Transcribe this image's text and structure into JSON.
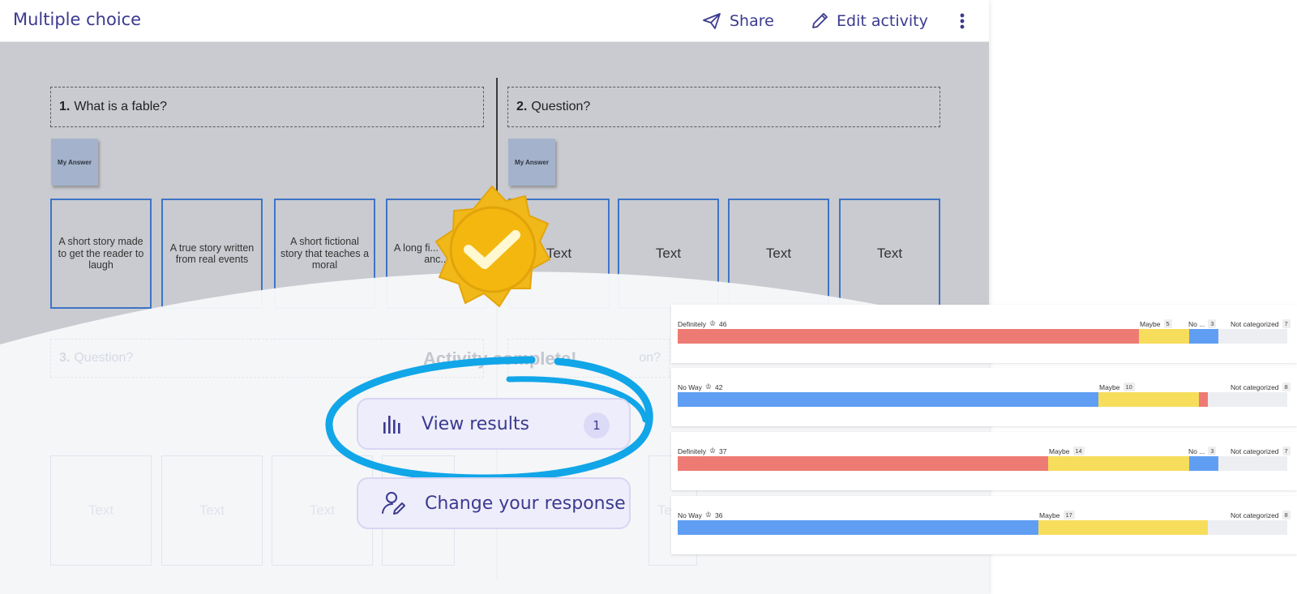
{
  "header": {
    "title": "Multiple choice",
    "share_label": "Share",
    "edit_label": "Edit activity"
  },
  "board": {
    "q1": {
      "num": "1.",
      "text": "What is a fable?"
    },
    "q2": {
      "num": "2.",
      "text": "Question?"
    },
    "q3": {
      "num": "3.",
      "text": "Question?"
    },
    "q4_partial": "on?",
    "sticky_label": "My Answer",
    "q1_options": [
      "A short story made to get the reader to laugh",
      "A true story written from real events",
      "A short fictional story that teaches a moral",
      "A long fi... with m... anc..."
    ],
    "q2_options": [
      "Text",
      "Text",
      "Text",
      "Text"
    ],
    "q3_options": [
      "Text",
      "Text",
      "Text",
      "Text"
    ],
    "q4_options": [
      "Text"
    ],
    "activity_complete": "Activity complete!"
  },
  "actions": {
    "view_results_label": "View results",
    "view_results_count": "1",
    "change_response_label": "Change your response"
  },
  "results": [
    {
      "left_label": "Definitely",
      "left_count": "46",
      "mid_label": "Maybe",
      "mid_count": "5",
      "third_label": "No ...",
      "third_count": "3",
      "nc_label": "Not categorized",
      "nc_count": "7",
      "segments": [
        {
          "color": "#ee7b73",
          "from": 0,
          "to": 0.757
        },
        {
          "color": "#f7dd5c",
          "from": 0.757,
          "to": 0.839
        },
        {
          "color": "#5f9ef3",
          "from": 0.839,
          "to": 0.887
        }
      ]
    },
    {
      "left_label": "No Way",
      "left_count": "42",
      "mid_label": "Maybe",
      "mid_count": "10",
      "third_label": "",
      "third_count": "",
      "nc_label": "Not categorized",
      "nc_count": "8",
      "segments": [
        {
          "color": "#5f9ef3",
          "from": 0,
          "to": 0.69
        },
        {
          "color": "#f7dd5c",
          "from": 0.69,
          "to": 0.855
        },
        {
          "color": "#ee7b73",
          "from": 0.855,
          "to": 0.87
        }
      ]
    },
    {
      "left_label": "Definitely",
      "left_count": "37",
      "mid_label": "Maybe",
      "mid_count": "14",
      "third_label": "No ...",
      "third_count": "3",
      "nc_label": "Not categorized",
      "nc_count": "7",
      "segments": [
        {
          "color": "#ee7b73",
          "from": 0,
          "to": 0.608
        },
        {
          "color": "#f7dd5c",
          "from": 0.608,
          "to": 0.839
        },
        {
          "color": "#5f9ef3",
          "from": 0.839,
          "to": 0.887
        }
      ]
    },
    {
      "left_label": "No Way",
      "left_count": "36",
      "mid_label": "Maybe",
      "mid_count": "17",
      "third_label": "",
      "third_count": "",
      "nc_label": "Not categorized",
      "nc_count": "8",
      "segments": [
        {
          "color": "#5f9ef3",
          "from": 0,
          "to": 0.592
        },
        {
          "color": "#f7dd5c",
          "from": 0.592,
          "to": 0.87
        }
      ]
    }
  ],
  "colors": {
    "accent": "#3b3a8f",
    "badge": "#f0b818",
    "highlight_ring": "#11a6e8"
  }
}
